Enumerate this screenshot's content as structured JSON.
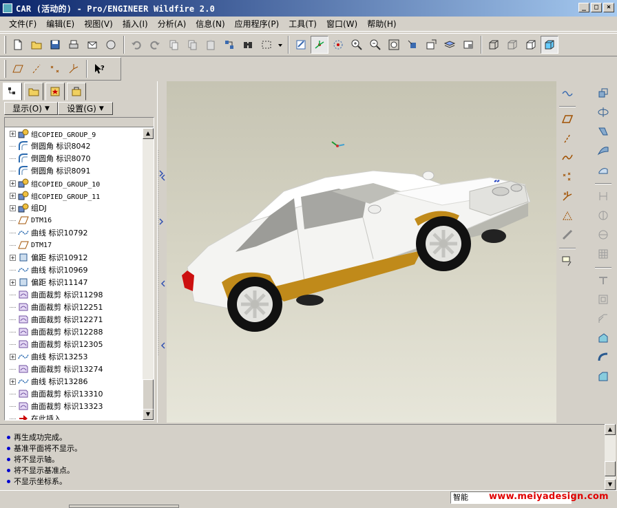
{
  "window": {
    "title": "CAR (活动的) - Pro/ENGINEER Wildfire 2.0",
    "min": "_",
    "max": "□",
    "close": "×"
  },
  "menu": [
    "文件(F)",
    "编辑(E)",
    "视图(V)",
    "插入(I)",
    "分析(A)",
    "信息(N)",
    "应用程序(P)",
    "工具(T)",
    "窗口(W)",
    "帮助(H)"
  ],
  "tree": {
    "show_label": "显示(O)",
    "settings_label": "设置(G)",
    "items": [
      {
        "label": "组COPIED_GROUP_9",
        "icon": "group-icon",
        "expandable": true
      },
      {
        "label": "倒圆角 标识8042",
        "icon": "round-icon",
        "expandable": false
      },
      {
        "label": "倒圆角 标识8070",
        "icon": "round-icon",
        "expandable": false
      },
      {
        "label": "倒圆角 标识8091",
        "icon": "round-icon",
        "expandable": false
      },
      {
        "label": "组COPIED_GROUP_10",
        "icon": "group-icon",
        "expandable": true
      },
      {
        "label": "组COPIED_GROUP_11",
        "icon": "group-icon",
        "expandable": true
      },
      {
        "label": "组DJ",
        "icon": "group-icon",
        "expandable": true
      },
      {
        "label": "DTM16",
        "icon": "datum-plane-icon",
        "expandable": false
      },
      {
        "label": "曲线 标识10792",
        "icon": "curve-icon",
        "expandable": false
      },
      {
        "label": "DTM17",
        "icon": "datum-plane-icon",
        "expandable": false
      },
      {
        "label": "偏距 标识10912",
        "icon": "offset-icon",
        "expandable": true
      },
      {
        "label": "曲线 标识10969",
        "icon": "curve-icon",
        "expandable": false
      },
      {
        "label": "偏距 标识11147",
        "icon": "offset-icon",
        "expandable": true
      },
      {
        "label": "曲面裁剪 标识11298",
        "icon": "trim-icon",
        "expandable": false
      },
      {
        "label": "曲面裁剪 标识12251",
        "icon": "trim-icon",
        "expandable": false
      },
      {
        "label": "曲面裁剪 标识12271",
        "icon": "trim-icon",
        "expandable": false
      },
      {
        "label": "曲面裁剪 标识12288",
        "icon": "trim-icon",
        "expandable": false
      },
      {
        "label": "曲面裁剪 标识12305",
        "icon": "trim-icon",
        "expandable": false
      },
      {
        "label": "曲线 标识13253",
        "icon": "curve-icon",
        "expandable": true
      },
      {
        "label": "曲面裁剪 标识13274",
        "icon": "trim-icon",
        "expandable": false
      },
      {
        "label": "曲线 标识13286",
        "icon": "curve-icon",
        "expandable": true
      },
      {
        "label": "曲面裁剪 标识13310",
        "icon": "trim-icon",
        "expandable": false
      },
      {
        "label": "曲面裁剪 标识13323",
        "icon": "trim-icon",
        "expandable": false
      },
      {
        "label": "在此插入",
        "icon": "insert-here-icon",
        "expandable": false
      }
    ]
  },
  "messages": [
    "再生成功完成。",
    "基准平面将不显示。",
    "将不显示轴。",
    "将不显示基准点。",
    "不显示坐标系。"
  ],
  "status": {
    "filter_value": "智能"
  },
  "watermark": "www.meiyadesign.com",
  "colors": {
    "title_start": "#0a246a",
    "title_end": "#a6caf0",
    "body_trim": "#c08a1a",
    "taillight": "#cc1010",
    "message_dot": "#0000d0"
  }
}
